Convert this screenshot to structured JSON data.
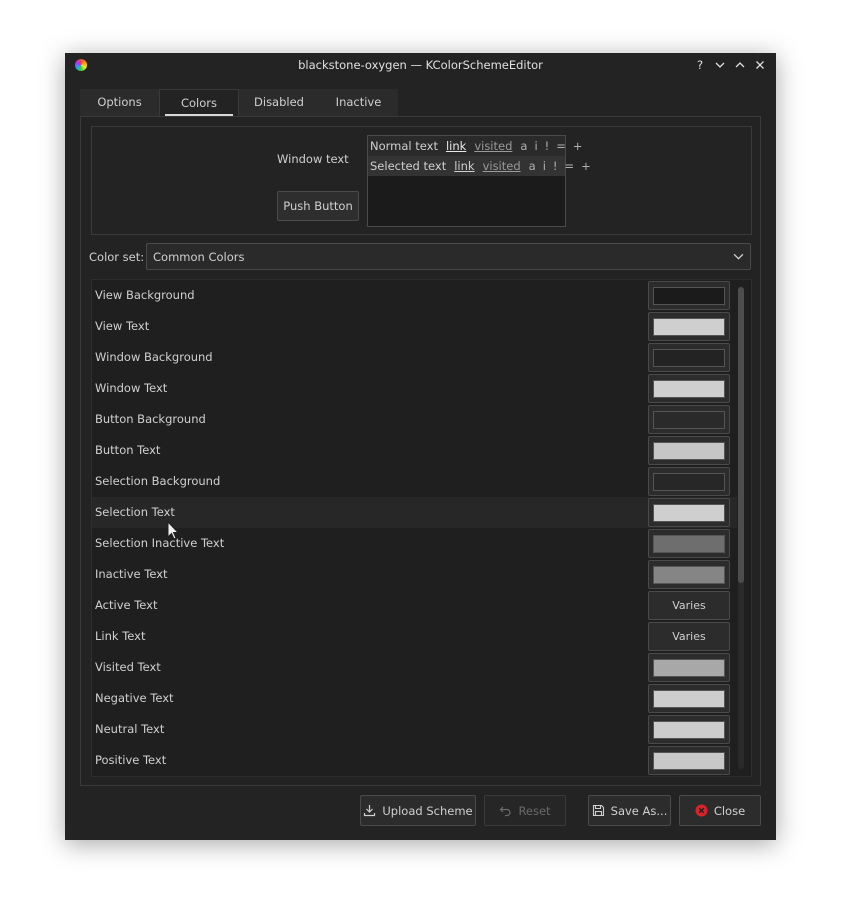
{
  "window": {
    "title": "blackstone-oxygen — KColorSchemeEditor"
  },
  "titlebar_buttons": {
    "help": "?",
    "minimize": "⌄",
    "maximize": "⌃",
    "close": "✕"
  },
  "tabs": [
    {
      "label": "Options"
    },
    {
      "label": "Colors"
    },
    {
      "label": "Disabled"
    },
    {
      "label": "Inactive"
    }
  ],
  "active_tab": "Colors",
  "preview": {
    "window_text": "Window text",
    "push_button": "Push Button",
    "normal_row": {
      "text": "Normal text",
      "link": "link",
      "visited": "visited",
      "symbols": [
        "a",
        "i",
        "!",
        "=",
        "+"
      ]
    },
    "selected_row": {
      "text": "Selected text",
      "link": "link",
      "visited": "visited",
      "symbols": [
        "a",
        "i",
        "!",
        "=",
        "+"
      ]
    }
  },
  "color_set": {
    "label": "Color set:",
    "value": "Common Colors"
  },
  "color_rows": [
    {
      "label": "View Background",
      "color": "#1b1b1b"
    },
    {
      "label": "View Text",
      "color": "#cfcfcf"
    },
    {
      "label": "Window Background",
      "color": "#232323"
    },
    {
      "label": "Window Text",
      "color": "#cfcfcf"
    },
    {
      "label": "Button Background",
      "color": "#2a2a2a"
    },
    {
      "label": "Button Text",
      "color": "#c6c6c6"
    },
    {
      "label": "Selection Background",
      "color": "#272727"
    },
    {
      "label": "Selection Text",
      "color": "#cfcfcf"
    },
    {
      "label": "Selection Inactive Text",
      "color": "#6e6e6e"
    },
    {
      "label": "Inactive Text",
      "color": "#858585"
    },
    {
      "label": "Active Text",
      "varies": "Varies"
    },
    {
      "label": "Link Text",
      "varies": "Varies"
    },
    {
      "label": "Visited Text",
      "color": "#a8a8a8"
    },
    {
      "label": "Negative Text",
      "color": "#cdcdcd"
    },
    {
      "label": "Neutral Text",
      "color": "#cdcdcd"
    },
    {
      "label": "Positive Text",
      "color": "#c8c8c8"
    }
  ],
  "footer": {
    "upload": "Upload Scheme",
    "reset": "Reset",
    "save_as": "Save As...",
    "close": "Close"
  },
  "colors": {
    "window_bg": "#232323",
    "accent_close": "#d9232b"
  }
}
